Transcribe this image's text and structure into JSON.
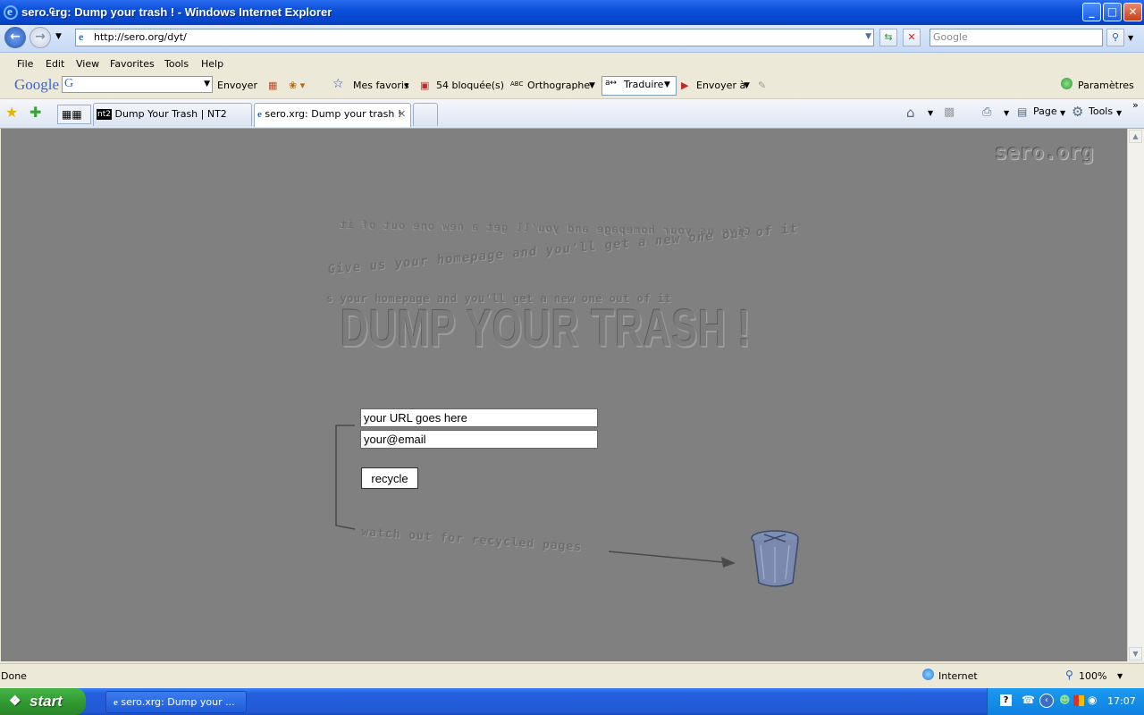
{
  "window": {
    "title": "sero.₠rg: Dump your trash ! - Windows Internet Explorer",
    "controls": {
      "minimize": "_",
      "maximize": "□",
      "close": "✕"
    }
  },
  "address_bar": {
    "url": "http://sero.org/dyt/",
    "search_placeholder": "Google"
  },
  "menu": [
    "File",
    "Edit",
    "View",
    "Favorites",
    "Tools",
    "Help"
  ],
  "google_toolbar": {
    "logo": "Google",
    "search_label": "Envoyer",
    "favorites": "Mes favoris",
    "blocked": "54 bloquée(s)",
    "spell": "Orthographe",
    "spell_icon": "ABC",
    "translate": "Traduire",
    "send": "Envoyer à",
    "settings": "Paramètres"
  },
  "tabs": [
    {
      "label": "Dump Your Trash | NT2",
      "icon": "nt2"
    },
    {
      "label": "sero.xrg: Dump your trash !",
      "active": true
    }
  ],
  "command_bar": {
    "page": "Page",
    "tools": "Tools"
  },
  "page": {
    "logo": "sero.org",
    "mirrored_text": "Give us your homepage and you'll get a new one out of it",
    "tagline_wavy": "Give us your homepage and you'll get a new one out of it",
    "tagline_flat": "s your homepage and you'll get a new one out of it",
    "heading": "DUMP YOUR TRASH !",
    "url_input_value": "your URL goes here",
    "email_input_value": "your@email",
    "button_label": "recycle",
    "footer_note": "watch out for recycled pages"
  },
  "status_bar": {
    "status": "Done",
    "zone": "Internet",
    "zoom": "100%"
  },
  "taskbar": {
    "start": "start",
    "window_task": "sero.xrg: Dump your ...",
    "clock": "17:07"
  }
}
